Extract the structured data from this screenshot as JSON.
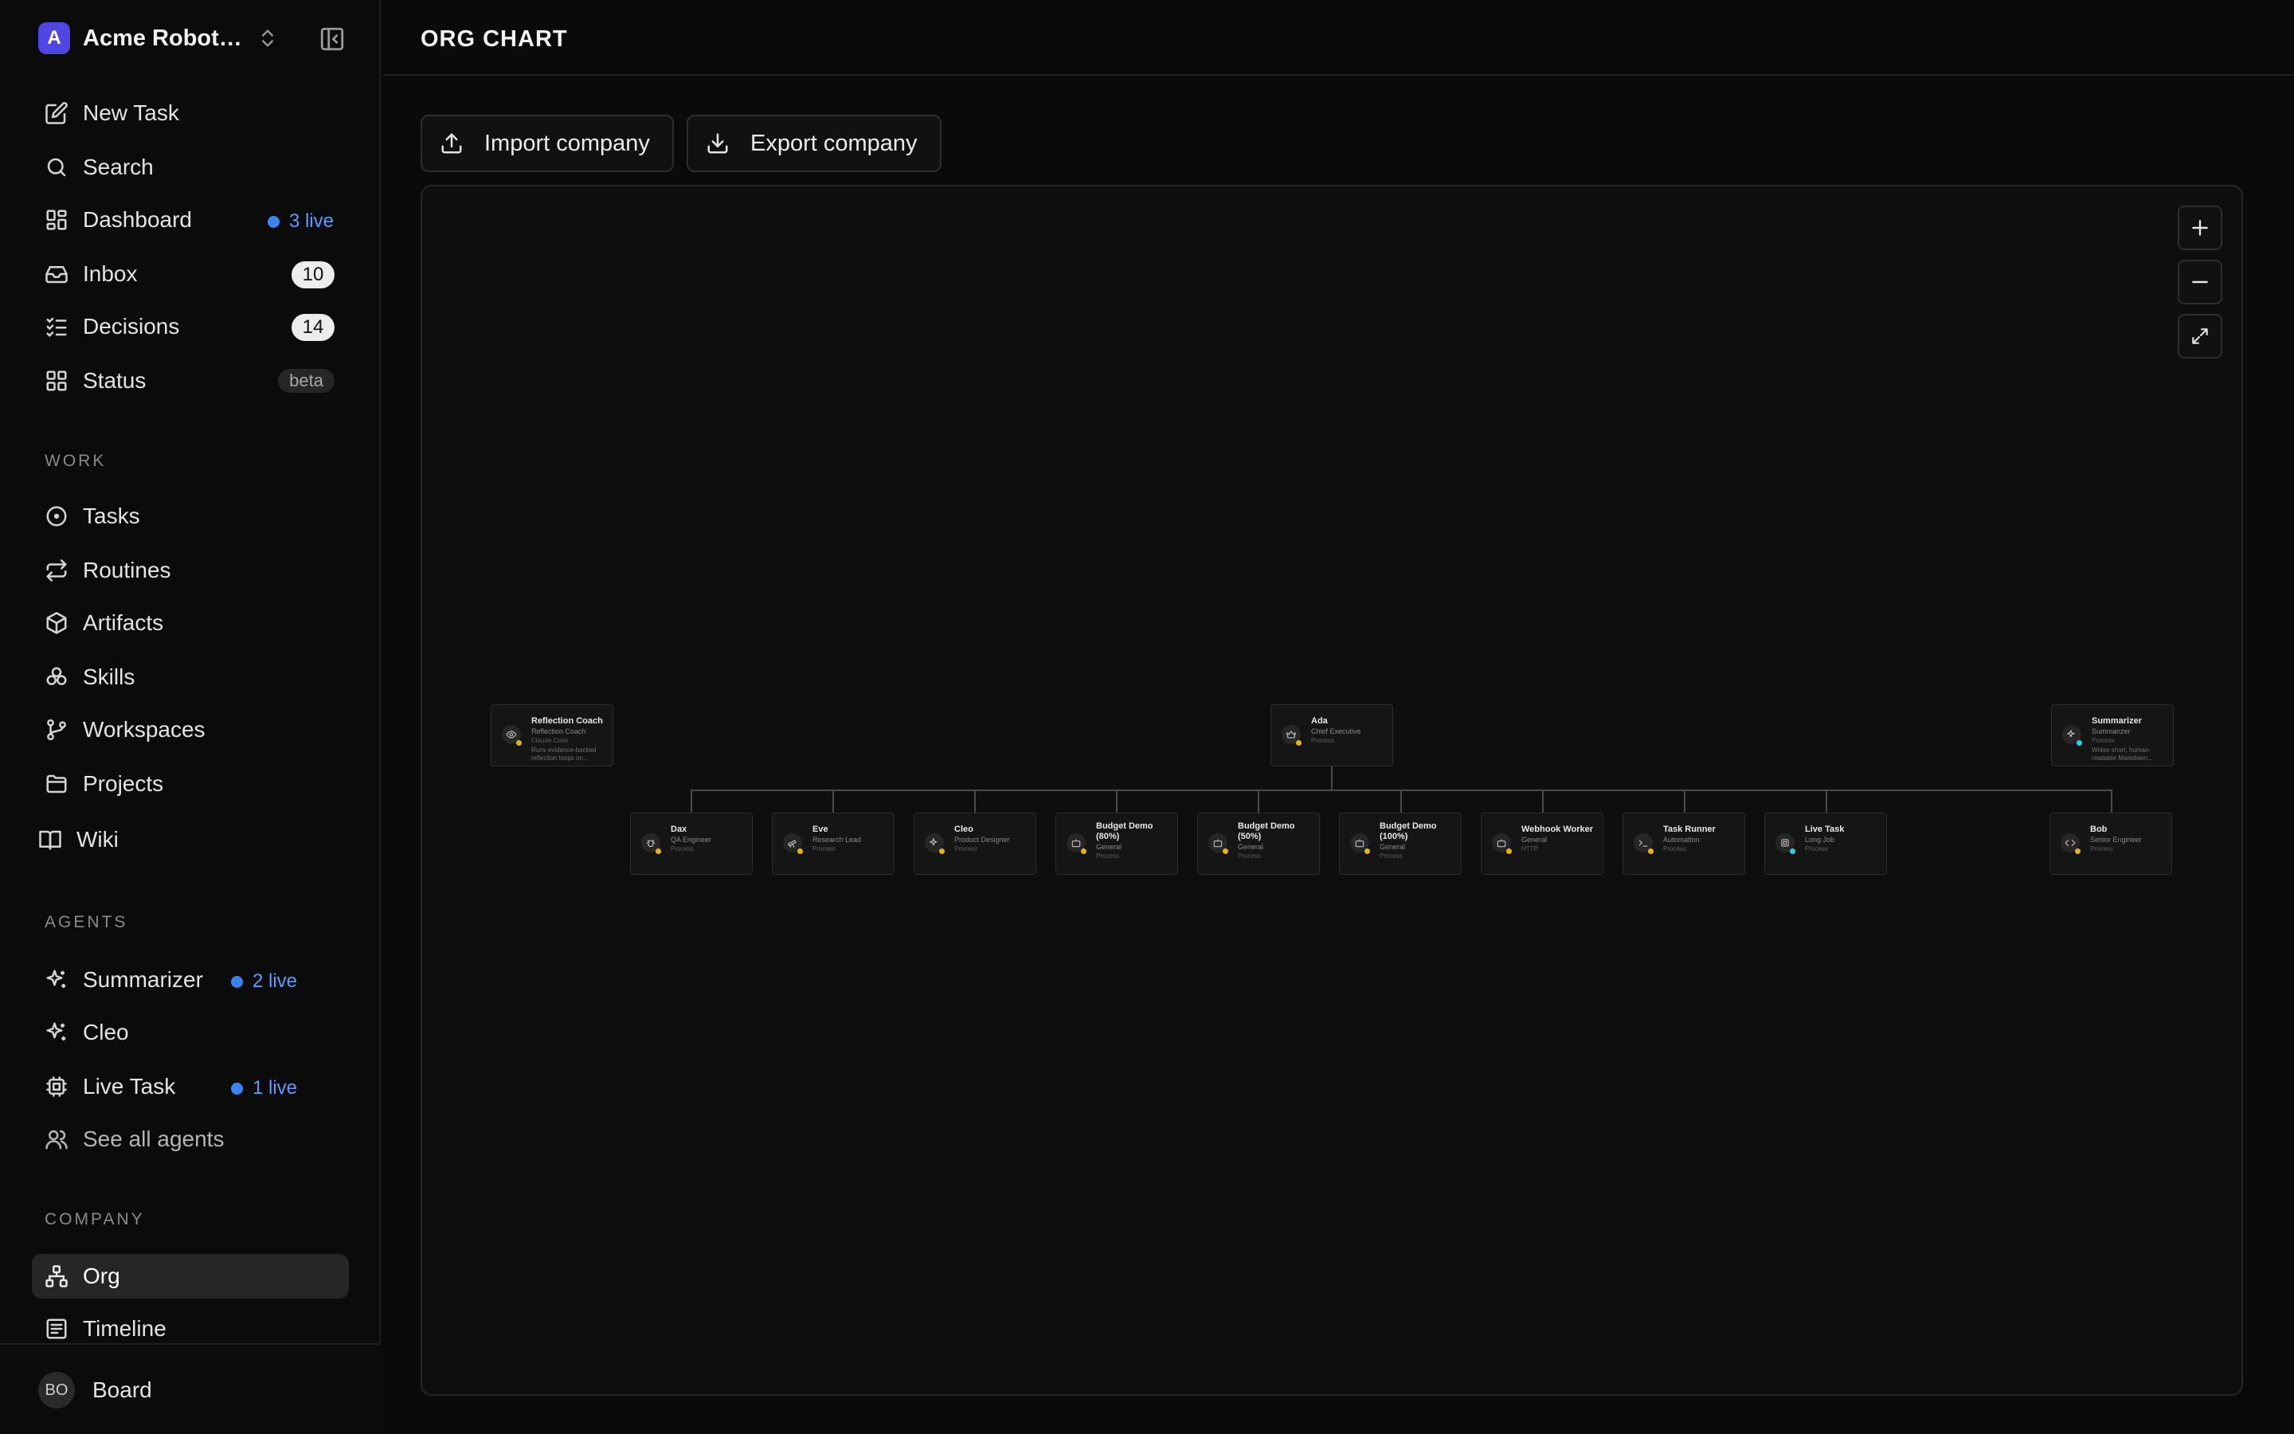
{
  "sidebar": {
    "company_name": "Acme Robotics",
    "company_initial": "A",
    "nav": [
      {
        "label": "New Task",
        "icon": "pencil-square-icon"
      },
      {
        "label": "Search",
        "icon": "search-icon"
      },
      {
        "label": "Dashboard",
        "icon": "dashboard-icon",
        "live": "3 live"
      },
      {
        "label": "Inbox",
        "icon": "inbox-icon",
        "count": "10"
      },
      {
        "label": "Decisions",
        "icon": "checklist-icon",
        "count": "14"
      },
      {
        "label": "Status",
        "icon": "grid-icon",
        "badge": "beta"
      }
    ],
    "work_label": "WORK",
    "work": [
      {
        "label": "Tasks",
        "icon": "circle-dot-icon"
      },
      {
        "label": "Routines",
        "icon": "repeat-icon"
      },
      {
        "label": "Artifacts",
        "icon": "cube-icon"
      },
      {
        "label": "Skills",
        "icon": "skills-icon"
      },
      {
        "label": "Workspaces",
        "icon": "git-branch-icon"
      },
      {
        "label": "Projects",
        "icon": "folder-icon"
      },
      {
        "label": "Wiki",
        "icon": "book-icon"
      }
    ],
    "agents_label": "AGENTS",
    "agents": [
      {
        "label": "Summarizer",
        "icon": "sparkles-icon",
        "live": "2 live"
      },
      {
        "label": "Cleo",
        "icon": "sparkles-icon"
      },
      {
        "label": "Live Task",
        "icon": "cpu-icon",
        "live": "1 live"
      },
      {
        "label": "See all agents",
        "icon": "users-icon"
      }
    ],
    "company_label": "COMPANY",
    "company": [
      {
        "label": "Org",
        "icon": "org-icon",
        "active": true
      },
      {
        "label": "Timeline",
        "icon": "timeline-icon"
      }
    ],
    "footer": {
      "initials": "BO",
      "label": "Board"
    }
  },
  "header": {
    "title": "ORG CHART"
  },
  "toolbar": {
    "import_label": "Import company",
    "export_label": "Export company"
  },
  "org": {
    "root": {
      "name": "Ada",
      "role": "Chief Executive",
      "adapter": "Process",
      "icon": "crown-icon",
      "status": "yellow"
    },
    "isolated": [
      {
        "name": "Reflection Coach",
        "role": "Reflection Coach",
        "adapter": "Claude Code",
        "desc": "Runs evidence-backed reflection loops on...",
        "icon": "eye-icon",
        "status": "yellow"
      },
      {
        "name": "Summarizer",
        "role": "Summarizer",
        "adapter": "Process",
        "desc": "Writes short, human-readable Markdown...",
        "icon": "sparkles-icon",
        "status": "cyan"
      }
    ],
    "reports": [
      {
        "name": "Dax",
        "role": "QA Engineer",
        "adapter": "Process",
        "icon": "bug-icon",
        "status": "yellow"
      },
      {
        "name": "Eve",
        "role": "Research Lead",
        "adapter": "Process",
        "icon": "telescope-icon",
        "status": "yellow"
      },
      {
        "name": "Cleo",
        "role": "Product Designer",
        "adapter": "Process",
        "icon": "sparkles-icon",
        "status": "yellow"
      },
      {
        "name": "Budget Demo (80%)",
        "role": "General",
        "adapter": "Process",
        "icon": "bot-icon",
        "status": "yellow"
      },
      {
        "name": "Budget Demo (50%)",
        "role": "General",
        "adapter": "Process",
        "icon": "bot-icon",
        "status": "yellow"
      },
      {
        "name": "Budget Demo (100%)",
        "role": "General",
        "adapter": "Process",
        "icon": "bot-icon",
        "status": "yellow"
      },
      {
        "name": "Webhook Worker",
        "role": "General",
        "adapter": "HTTP",
        "icon": "bot-icon",
        "status": "yellow"
      },
      {
        "name": "Task Runner",
        "role": "Automation",
        "adapter": "Process",
        "icon": "terminal-icon",
        "status": "yellow"
      },
      {
        "name": "Live Task",
        "role": "Long Job",
        "adapter": "Process",
        "icon": "cpu-icon",
        "status": "cyan"
      },
      {
        "name": "Bob",
        "role": "Senior Engineer",
        "adapter": "Process",
        "icon": "code-icon",
        "status": "yellow"
      }
    ]
  },
  "colors": {
    "accent": "#4f46e5",
    "live": "#3b82f6",
    "status_yellow": "#eab308",
    "status_cyan": "#22d3ee"
  }
}
